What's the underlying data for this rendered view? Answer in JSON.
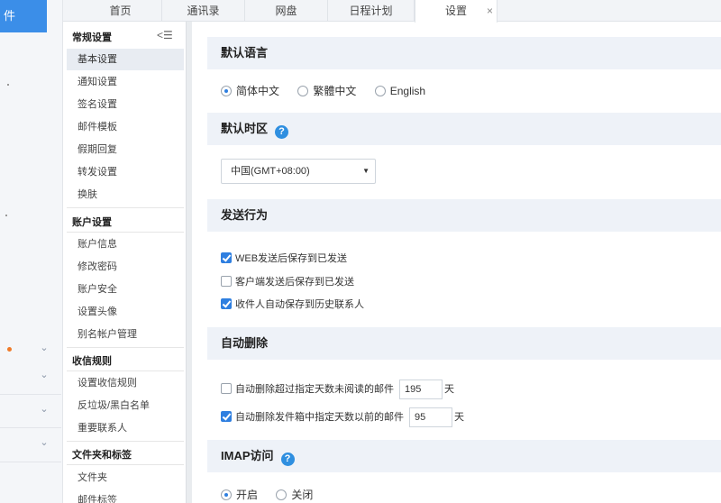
{
  "left": {
    "compose_text": "件"
  },
  "tabs": [
    {
      "label": "首页"
    },
    {
      "label": "通讯录"
    },
    {
      "label": "网盘"
    },
    {
      "label": "日程计划"
    },
    {
      "label": "设置"
    }
  ],
  "tab_close": "×",
  "nav": {
    "collapse_glyph": "<☰",
    "groups": [
      {
        "title": "常规设置",
        "items": [
          "基本设置",
          "通知设置",
          "签名设置",
          "邮件模板",
          "假期回复",
          "转发设置",
          "换肤"
        ]
      },
      {
        "title": "账户设置",
        "items": [
          "账户信息",
          "修改密码",
          "账户安全",
          "设置头像",
          "别名帐户管理"
        ]
      },
      {
        "title": "收信规则",
        "items": [
          "设置收信规则",
          "反垃圾/黑白名单",
          "重要联系人"
        ]
      },
      {
        "title": "文件夹和标签",
        "items": [
          "文件夹",
          "邮件标签"
        ]
      }
    ]
  },
  "sections": {
    "language": {
      "title": "默认语言",
      "options": [
        "简体中文",
        "繁體中文",
        "English"
      ],
      "selected": "简体中文"
    },
    "timezone": {
      "title": "默认时区",
      "help": "?",
      "value": "中国(GMT+08:00)",
      "arrow": "▼"
    },
    "send": {
      "title": "发送行为",
      "options": [
        {
          "label": "WEB发送后保存到已发送",
          "checked": true
        },
        {
          "label": "客户端发送后保存到已发送",
          "checked": false
        },
        {
          "label": "收件人自动保存到历史联系人",
          "checked": true
        }
      ]
    },
    "autodelete": {
      "title": "自动删除",
      "unread": {
        "label": "自动删除超过指定天数未阅读的邮件",
        "checked": false,
        "days": "195",
        "unit": "天"
      },
      "sent": {
        "label": "自动删除发件箱中指定天数以前的邮件",
        "checked": true,
        "days": "95",
        "unit": "天"
      }
    },
    "imap": {
      "title": "IMAP访问",
      "help": "?",
      "options": [
        "开启",
        "关闭"
      ],
      "selected": "开启"
    }
  }
}
